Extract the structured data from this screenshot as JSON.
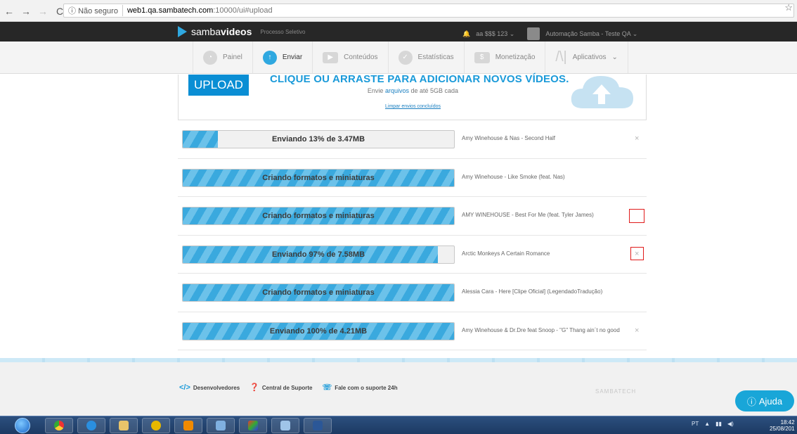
{
  "browser": {
    "security": "Não seguro",
    "host": "web1.qa.sambatech.com",
    "path": ":10000/ui#upload"
  },
  "header": {
    "logo_regular": "samba",
    "logo_bold": "videos",
    "project": "Processo Seletivo",
    "account": "aa $$$ 123",
    "user": "Automação Samba - Teste QA"
  },
  "nav": {
    "tabs": [
      {
        "label": "Painel"
      },
      {
        "label": "Enviar"
      },
      {
        "label": "Conteúdos"
      },
      {
        "label": "Estatísticas"
      },
      {
        "label": "Monetização"
      },
      {
        "label": "Aplicativos"
      }
    ]
  },
  "upload": {
    "button": "UPLOAD",
    "title": "CLIQUE OU ARRASTE PARA ADICIONAR NOVOS VÍDEOS.",
    "sub_prefix": "Envie",
    "sub_link": "arquivos",
    "sub_suffix": "de até 5GB cada",
    "clear": "Limpar envios concluídos"
  },
  "rows": [
    {
      "status": "Enviando 13% de 3.47MB",
      "progress": 0.13,
      "title": "Amy Winehouse & Nas - Second Half",
      "close": "×"
    },
    {
      "status": "Criando formatos e miniaturas",
      "progress": 1.0,
      "title": "Amy Winehouse - Like Smoke (feat. Nas)",
      "close": ""
    },
    {
      "status": "Criando formatos e miniaturas",
      "progress": 1.0,
      "title": "AMY WINEHOUSE - Best For Me (feat. Tyler James)",
      "close": ""
    },
    {
      "status": "Enviando 97% de 7.58MB",
      "progress": 0.94,
      "title": "Arctic Monkeys A Certain Romance",
      "close": "×"
    },
    {
      "status": "Criando formatos e miniaturas",
      "progress": 1.0,
      "title": "Alessia Cara - Here [Clipe Oficial] (LegendadoTradução)",
      "close": ""
    },
    {
      "status": "Enviando 100% de 4.21MB",
      "progress": 1.0,
      "title": "Amy Winehouse & Dr.Dre feat Snoop - \"G\" Thang ain´t no good",
      "close": "×"
    }
  ],
  "footer": {
    "dev": "Desenvolvedores",
    "support": "Central de Suporte",
    "contact": "Fale com o suporte 24h",
    "brand": "SAMBATECH",
    "help": "Ajuda"
  },
  "taskbar": {
    "lang": "PT",
    "time": "18:42",
    "date": "25/08/201"
  }
}
